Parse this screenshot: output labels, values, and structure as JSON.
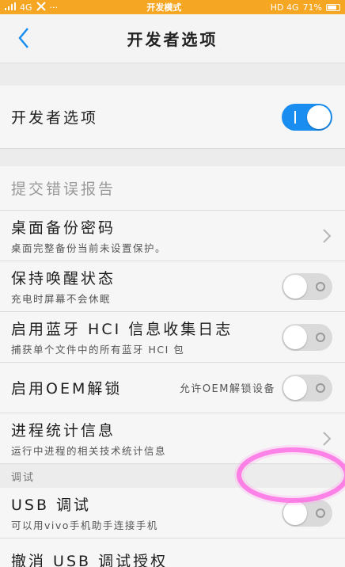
{
  "status_bar": {
    "signal": "4G",
    "title": "开发模式",
    "network": "HD 4G",
    "battery": "71%"
  },
  "header": {
    "title": "开发者选项"
  },
  "master": {
    "title": "开发者选项",
    "state": "on"
  },
  "items": {
    "bug_report": {
      "title": "提交错误报告"
    },
    "desktop_backup": {
      "title": "桌面备份密码",
      "subtitle": "桌面完整备份当前未设置保护。"
    },
    "stay_awake": {
      "title": "保持唤醒状态",
      "subtitle": "充电时屏幕不会休眠",
      "state": "off"
    },
    "bt_hci": {
      "title": "启用蓝牙 HCI 信息收集日志",
      "subtitle": "捕获单个文件中的所有蓝牙 HCI 包",
      "state": "off"
    },
    "oem_unlock": {
      "title": "启用OEM解锁",
      "note": "允许OEM解锁设备",
      "state": "off"
    },
    "process_stats": {
      "title": "进程统计信息",
      "subtitle": "运行中进程的相关技术统计信息"
    }
  },
  "debug_section": {
    "label": "调试",
    "usb_debug": {
      "title": "USB 调试",
      "subtitle": "可以用vivo手机助手连接手机",
      "state": "off"
    },
    "revoke": {
      "title": "撤消 USB 调试授权"
    }
  },
  "colors": {
    "status_bar": "#f5a623",
    "accent": "#1a8df0",
    "highlight": "#ff44dd"
  }
}
